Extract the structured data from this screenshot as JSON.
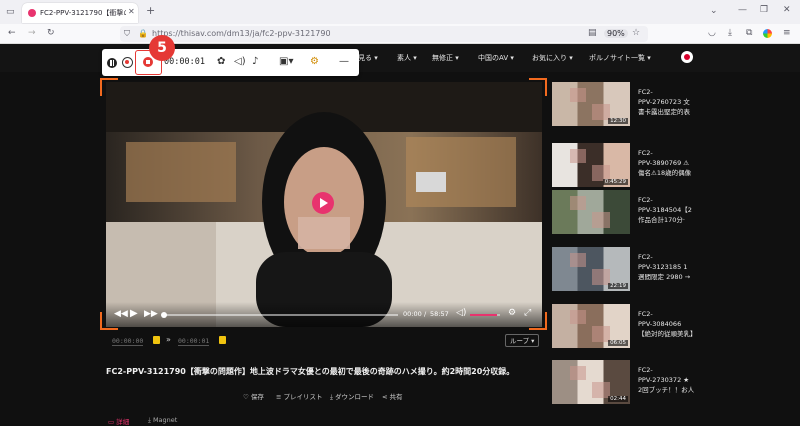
{
  "browser": {
    "tab_title": "FC2-PPV-3121790【衝撃の問題",
    "url": "https://thisav.com/dm13/ja/fc2-ppv-3121790",
    "zoom": "90%"
  },
  "nav": {
    "items": [
      "見る ▾",
      "素人 ▾",
      "無修正 ▾",
      "中国のAV ▾",
      "お気に入り ▾",
      "ポルノサイト一覧 ▾"
    ]
  },
  "recorder": {
    "step_badge": "5",
    "timer": "00:00:01"
  },
  "player": {
    "current_time": "00:00",
    "separator": "/",
    "duration": "58:57",
    "ab_start": "00:00:00",
    "ab_end": "00:00:01",
    "loop_label": "ループ ▾",
    "progress": 0.0,
    "volume": 0.9
  },
  "video": {
    "title": "FC2-PPV-3121790【衝撃の問題作】地上波ドラマ女優との最初で最後の奇跡のハメ撮り。約2時間20分収録。",
    "actions": [
      "保存",
      "プレイリスト",
      "ダウンロード",
      "共有"
    ],
    "tabs": [
      "詳細",
      "Magnet"
    ]
  },
  "related": [
    {
      "title_l1": "FC2-",
      "title_l2": "PPV-2760723 文",
      "title_l3": "書卡露出堅定的表",
      "duration": "12:30"
    },
    {
      "title_l1": "FC2-",
      "title_l2": "PPV-3890769 ⚠",
      "title_l3": "傷名⚠18歳的偶像",
      "duration": "0:45:29"
    },
    {
      "title_l1": "FC2-",
      "title_l2": "PPV-3184504【2",
      "title_l3": "作品合計170分·",
      "duration": ""
    },
    {
      "title_l1": "FC2-",
      "title_l2": "PPV-3123185 1",
      "title_l3": "週間限定 2980 →",
      "duration": "22:19"
    },
    {
      "title_l1": "FC2-",
      "title_l2": "PPV-3084066",
      "title_l3": "【絶対的従順美乳】",
      "duration": "06:05"
    },
    {
      "title_l1": "FC2-",
      "title_l2": "PPV-2730372 ★",
      "title_l3": "2回ブッチ！！お人",
      "duration": "02:44"
    }
  ],
  "colors": {
    "accent": "#e8336e",
    "record_red": "#e53935",
    "frame_orange": "#f26a1f"
  }
}
